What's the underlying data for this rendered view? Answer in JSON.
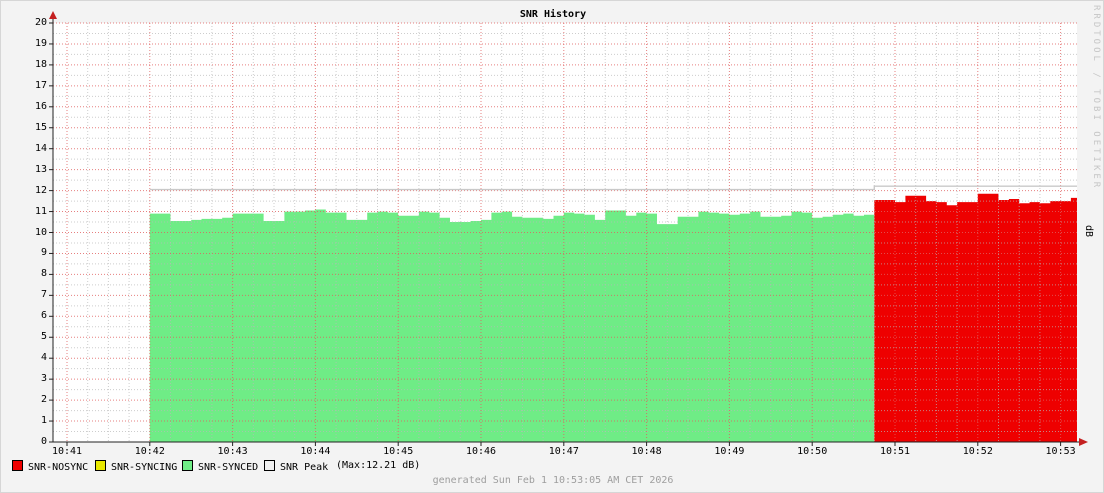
{
  "title": "SNR History",
  "watermark": "RRDTOOL / TOBI OETIKER",
  "y_axis_unit": "dB",
  "footer": "generated Sun Feb  1 10:53:05 AM CET 2026",
  "legend": [
    {
      "label": "SNR-NOSYNC",
      "color": "#ee0000"
    },
    {
      "label": "SNR-SYNCING",
      "color": "#e8e800"
    },
    {
      "label": "SNR-SYNCED",
      "color": "#6fec86"
    },
    {
      "label": "SNR Peak",
      "color": "#f0f0f0"
    }
  ],
  "legend_note": "(Max:12.21 dB)",
  "colors": {
    "plot_background": "#ffffff",
    "major_grid": "#e06060",
    "minor_grid": "#b8b8b8",
    "axis": "#222222",
    "arrow": "#c42020",
    "peak_line": "#c9c9c9"
  },
  "chart_data": {
    "type": "area",
    "title": "SNR History",
    "unit": "dB",
    "ylim": [
      0,
      20
    ],
    "y_tick_step": 1,
    "y_minor_step": 0.5,
    "x_tick_labels": [
      "10:41",
      "10:42",
      "10:43",
      "10:44",
      "10:45",
      "10:46",
      "10:47",
      "10:48",
      "10:49",
      "10:50",
      "10:51",
      "10:52",
      "10:53"
    ],
    "x_minor_step_minutes": 0.25,
    "x_axis_minutes_range": [
      -0.17,
      12.25
    ],
    "sample_step_minutes": 0.125,
    "grid": true,
    "legend_position": "bottom",
    "series": [
      {
        "name": "SNR-SYNCED",
        "type": "area",
        "color": "#6fec86",
        "start_minute": 1.0,
        "values": [
          10.9,
          10.9,
          10.55,
          10.55,
          10.6,
          10.65,
          10.65,
          10.7,
          10.9,
          10.9,
          10.9,
          10.55,
          10.55,
          11.0,
          11.0,
          11.05,
          11.1,
          10.95,
          10.95,
          10.6,
          10.6,
          10.95,
          11.0,
          10.95,
          10.8,
          10.8,
          11.0,
          10.95,
          10.7,
          10.5,
          10.5,
          10.55,
          10.6,
          10.95,
          11.0,
          10.75,
          10.7,
          10.7,
          10.65,
          10.8,
          10.95,
          10.9,
          10.85,
          10.6,
          11.05,
          11.05,
          10.8,
          10.95,
          10.9,
          10.4,
          10.4,
          10.75,
          10.75,
          11.0,
          10.95,
          10.9,
          10.85,
          10.9,
          11.0,
          10.75,
          10.75,
          10.8,
          11.0,
          10.95,
          10.7,
          10.75,
          10.85,
          10.9,
          10.8,
          10.85
        ]
      },
      {
        "name": "SNR-NOSYNC",
        "type": "area",
        "color": "#ee0000",
        "start_minute": 9.75,
        "values": [
          11.55,
          11.55,
          11.45,
          11.75,
          11.75,
          11.5,
          11.45,
          11.3,
          11.45,
          11.45,
          11.85,
          11.85,
          11.55,
          11.6,
          11.4,
          11.45,
          11.4,
          11.5,
          11.5,
          11.65
        ]
      },
      {
        "name": "SNR-SYNCING",
        "type": "area",
        "color": "#e8e800",
        "start_minute": null,
        "values": []
      },
      {
        "name": "SNR Peak",
        "type": "line",
        "color": "#c9c9c9",
        "max": 12.21,
        "segments": [
          {
            "from_minute": 1.0,
            "to_minute": 9.75,
            "value": 12.05
          },
          {
            "from_minute": 9.75,
            "to_minute": 12.25,
            "value": 12.21
          }
        ]
      }
    ]
  }
}
